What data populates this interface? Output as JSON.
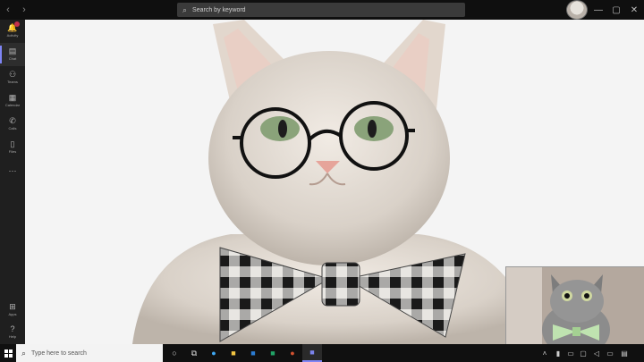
{
  "titlebar": {
    "back": "‹",
    "forward": "›",
    "search_placeholder": "Search by keyword",
    "minimize": "—",
    "maximize": "▢",
    "close": "✕"
  },
  "rail": {
    "items": [
      {
        "label": "Activity",
        "icon": "bell-icon",
        "glyph": "🔔"
      },
      {
        "label": "Chat",
        "icon": "chat-icon",
        "glyph": "▤"
      },
      {
        "label": "Teams",
        "icon": "teams-icon",
        "glyph": "⚇"
      },
      {
        "label": "Calendar",
        "icon": "calendar-icon",
        "glyph": "▦"
      },
      {
        "label": "Calls",
        "icon": "phone-icon",
        "glyph": "✆"
      },
      {
        "label": "Files",
        "icon": "file-icon",
        "glyph": "▯"
      },
      {
        "label": "",
        "icon": "more-icon",
        "glyph": "⋯"
      },
      {
        "label": "Apps",
        "icon": "apps-icon",
        "glyph": "⊞"
      },
      {
        "label": "Help",
        "icon": "help-icon",
        "glyph": "?"
      }
    ]
  },
  "taskbar": {
    "search_placeholder": "Type here to search",
    "tray_time_hidden": ""
  },
  "colors": {
    "accent": "#7f85f5",
    "badge": "#c4314b"
  }
}
